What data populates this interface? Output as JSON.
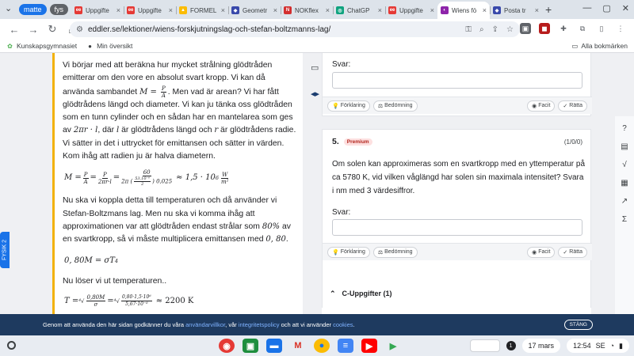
{
  "tabs": {
    "groups": [
      {
        "label": "matte",
        "color": "#1a73e8"
      },
      {
        "label": "fys",
        "color": "#5f6368"
      }
    ],
    "items": [
      {
        "title": "Uppgifte",
        "icon": "eddler-icon",
        "color": "#e53935",
        "glyph": "ee",
        "active": false
      },
      {
        "title": "Uppgifte",
        "icon": "eddler-icon",
        "color": "#e53935",
        "glyph": "ee",
        "active": false
      },
      {
        "title": "FORMEL",
        "icon": "drive-icon",
        "color": "#fbbc04",
        "glyph": "▲",
        "active": false
      },
      {
        "title": "Geometr",
        "icon": "geogebra-icon",
        "color": "#3949ab",
        "glyph": "◆",
        "active": false
      },
      {
        "title": "NOKflex",
        "icon": "nokflex-icon",
        "color": "#d32f2f",
        "glyph": "N",
        "active": false
      },
      {
        "title": "ChatGP",
        "icon": "chatgpt-icon",
        "color": "#10a37f",
        "glyph": "◎",
        "active": false
      },
      {
        "title": "Uppgifte",
        "icon": "eddler-icon",
        "color": "#e53935",
        "glyph": "ee",
        "active": false
      },
      {
        "title": "Wiens fö",
        "icon": "eddler-icon",
        "color": "#8e24aa",
        "glyph": "◐",
        "active": true
      },
      {
        "title": "Posta tr",
        "icon": "eddler-icon",
        "color": "#3949ab",
        "glyph": "◆",
        "active": false
      }
    ],
    "new_tab": "+"
  },
  "toolbar": {
    "url": "eddler.se/lektioner/wiens-forskjutningslag-och-stefan-boltzmanns-lag/"
  },
  "bookmarks": {
    "items": [
      {
        "label": "Kunskapsgymnasiet",
        "icon": "kunskapsgymnasiet-icon"
      },
      {
        "label": "Min översikt",
        "icon": "github-icon"
      }
    ],
    "all_label": "Alla bokmärken"
  },
  "lesson": {
    "p1_a": "Vi börjar med att beräkna hur mycket strålning glödtråden emitterar om den vore en absolut svart kropp. Vi kan då använda sambandet ",
    "p1_b": ". Men vad är arean? Vi har fått glödtrådens längd och diameter. Vi kan ju tänka oss glödtråden som en tunn cylinder och en sådan har en mantelarea som ges av ",
    "p1_area": "2πr · l",
    "p1_c": ", där ",
    "p1_l": "l",
    "p1_d": " är glödtrådens längd och ",
    "p1_r": "r",
    "p1_e": " är glödtrådens radie. Vi sätter in det i uttrycket för emittansen och sätter in värden. Kom ihåg att radien ju är halva diametern.",
    "eq1_result": "≈ 1,5 · 10",
    "eq1_exp": "6",
    "eq1_unit_num": "W",
    "eq1_unit_den": "m²",
    "p2_a": "Nu ska vi koppla detta till temperaturen och då använder vi Stefan-Boltzmans lag. Men nu ska vi komma ihåg att approximationen var att glödtråden endast strålar som ",
    "p2_pct": "80%",
    "p2_b": " av en svartkropp, så vi måste multiplicera emittansen med ",
    "p2_val": "0, 80",
    "p2_c": ".",
    "eq2": "0, 80M = σT",
    "eq2_exp": "4",
    "p3": "Nu löser vi ut temperaturen..",
    "eq3_result": "≈ 2200 K"
  },
  "question4": {
    "svar_label": "Svar:",
    "buttons": {
      "forklaring": "Förklaring",
      "bedomning": "Bedömning",
      "facit": "Facit",
      "ratta": "Rätta"
    }
  },
  "question5": {
    "number": "5.",
    "badge": "Premium",
    "points": "(1/0/0)",
    "text": "Om solen kan approximeras som en svartkropp med en yttemperatur på ca 5780 K, vid vilken våglängd har solen sin maximala intensitet? Svara i nm med 3 värdesiffror.",
    "svar_label": "Svar:",
    "buttons": {
      "forklaring": "Förklaring",
      "bedomning": "Bedömning",
      "facit": "Facit",
      "ratta": "Rätta"
    }
  },
  "section": {
    "label": "C-Uppgifter (1)"
  },
  "side_tab": {
    "label": "FYSIK 2"
  },
  "cookie": {
    "pre": "Genom att använda den här sidan godkänner du våra ",
    "link1": "användarvillkor",
    "mid1": ", vår ",
    "link2": "integritetspolicy",
    "mid2": " och att vi använder ",
    "link3": "cookies",
    "post": ".",
    "close": "STÄNG"
  },
  "shelf": {
    "notification_count": "1",
    "date": "17 mars",
    "time": "12:54",
    "locale": "SE"
  }
}
